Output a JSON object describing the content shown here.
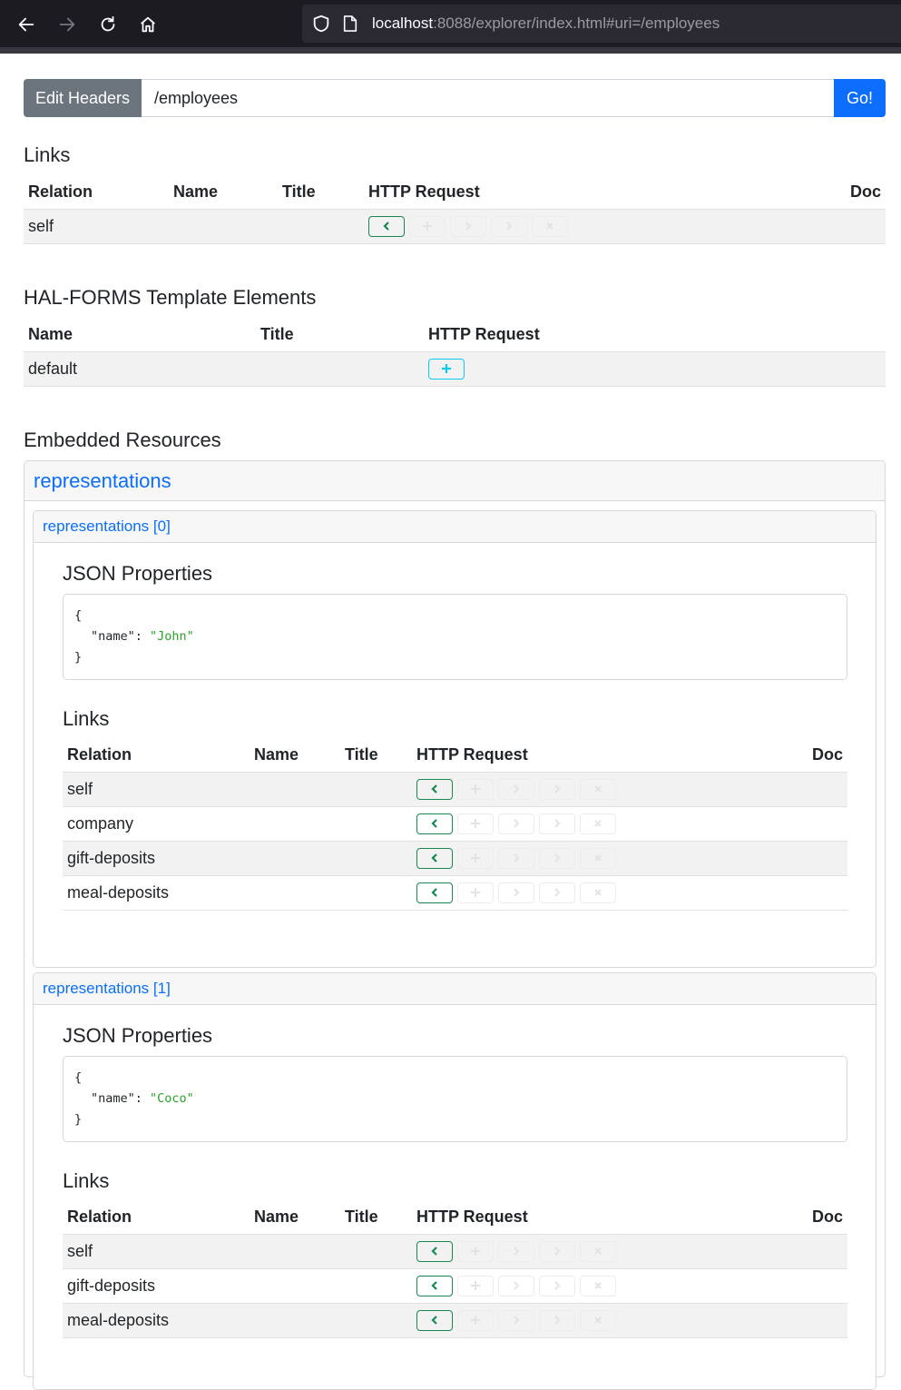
{
  "browser": {
    "url_host": "localhost",
    "url_rest": ":8088/explorer/index.html#uri=/employees"
  },
  "request": {
    "edit_headers_label": "Edit Headers",
    "uri_value": "/employees",
    "go_label": "Go!"
  },
  "links": {
    "title": "Links",
    "headers": [
      "Relation",
      "Name",
      "Title",
      "HTTP Request",
      "Doc"
    ],
    "rows": [
      {
        "relation": "self",
        "name": "",
        "title": "",
        "doc": ""
      }
    ]
  },
  "templates": {
    "title": "HAL-FORMS Template Elements",
    "headers": [
      "Name",
      "Title",
      "HTTP Request"
    ],
    "rows": [
      {
        "name": "default",
        "title": ""
      }
    ]
  },
  "embedded": {
    "title": "Embedded Resources",
    "group_label": "representations",
    "items": [
      {
        "label": "representations [0]",
        "json_title": "JSON Properties",
        "json_open": "{",
        "json_key": "\"name\"",
        "json_value": "\"John\"",
        "json_close": "}",
        "links_title": "Links",
        "links_headers": [
          "Relation",
          "Name",
          "Title",
          "HTTP Request",
          "Doc"
        ],
        "links_rows": [
          {
            "relation": "self"
          },
          {
            "relation": "company"
          },
          {
            "relation": "gift-deposits"
          },
          {
            "relation": "meal-deposits"
          }
        ]
      },
      {
        "label": "representations [1]",
        "json_title": "JSON Properties",
        "json_open": "{",
        "json_key": "\"name\"",
        "json_value": "\"Coco\"",
        "json_close": "}",
        "links_title": "Links",
        "links_headers": [
          "Relation",
          "Name",
          "Title",
          "HTTP Request",
          "Doc"
        ],
        "links_rows": [
          {
            "relation": "self"
          },
          {
            "relation": "gift-deposits"
          },
          {
            "relation": "meal-deposits"
          }
        ]
      }
    ]
  },
  "colors": {
    "primary": "#0d6efd",
    "secondary": "#6c757d",
    "get": "#198754",
    "post": "#0dcaf0",
    "json_string": "#2aa12a"
  },
  "icons": {
    "back": "arrow-left-icon",
    "forward": "arrow-right-icon",
    "reload": "reload-icon",
    "home": "home-icon",
    "shield": "shield-icon",
    "page": "page-icon",
    "get": "chevron-left-icon",
    "post": "plus-icon",
    "put": "chevron-right-icon",
    "patch": "chevron-right-icon",
    "delete": "x-icon"
  }
}
